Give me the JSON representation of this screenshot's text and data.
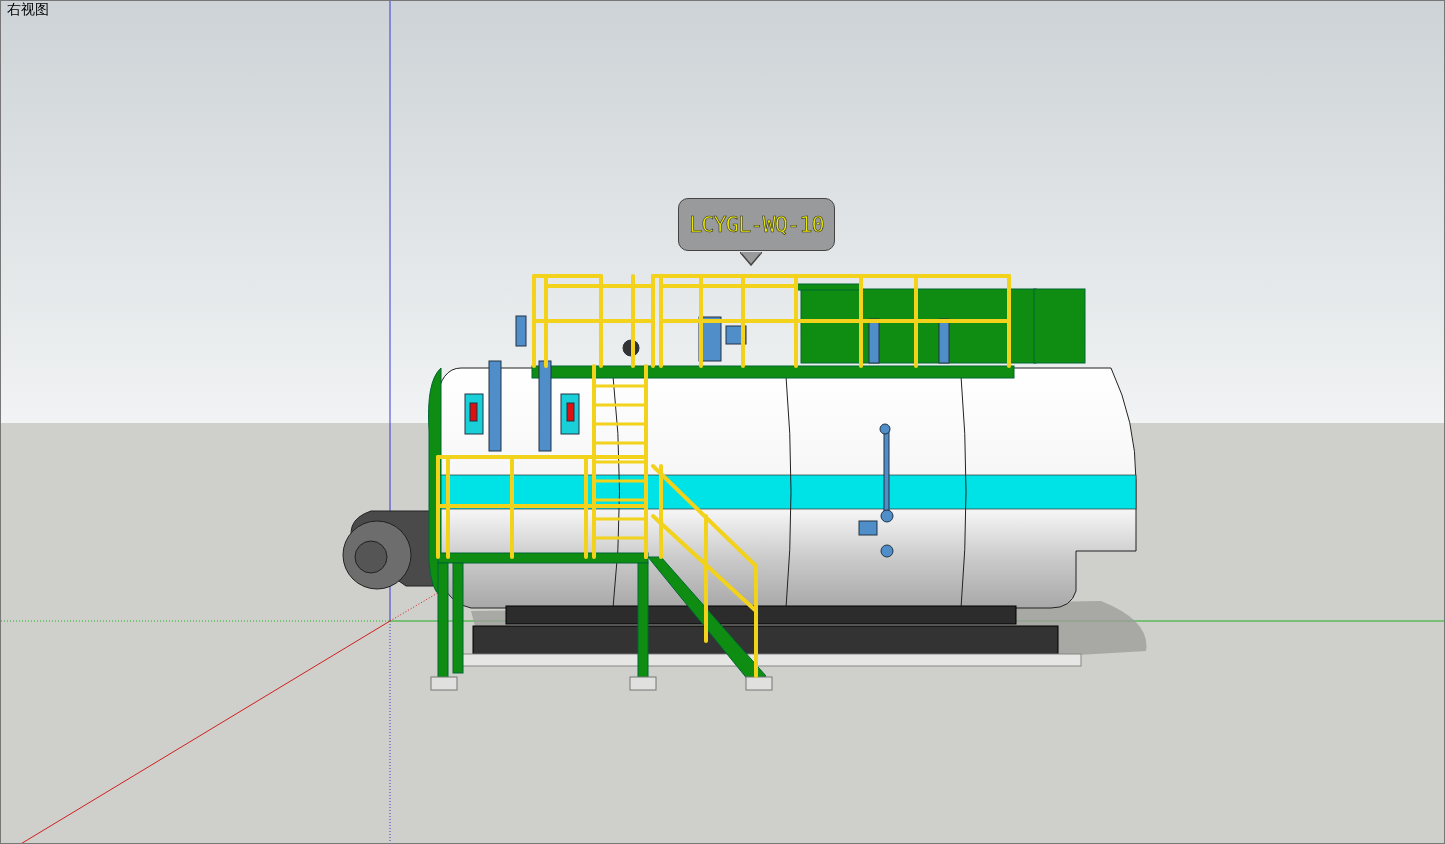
{
  "viewport": {
    "view_label": "右视图"
  },
  "callout": {
    "text": "LCYGL-WQ-10"
  }
}
